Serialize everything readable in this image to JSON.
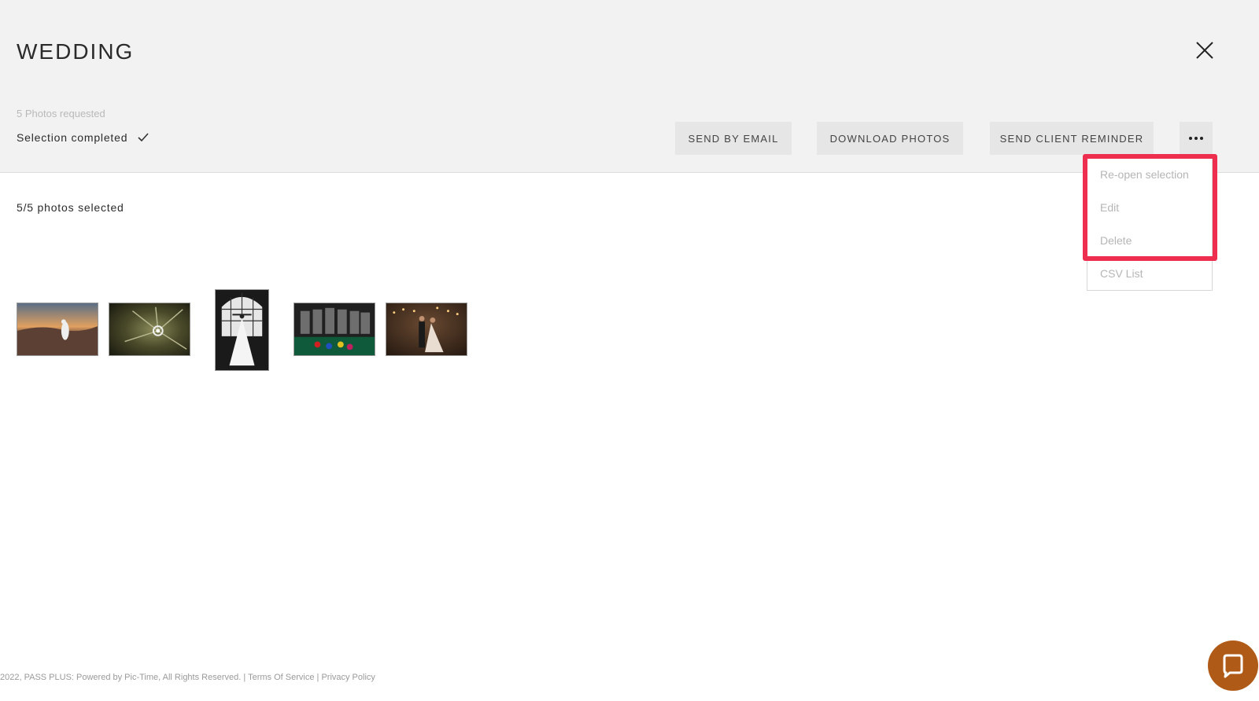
{
  "header": {
    "title": "WEDDING",
    "photos_requested": "5 Photos requested",
    "status_text": "Selection completed"
  },
  "actions": {
    "send_email": "SEND BY EMAIL",
    "download": "DOWNLOAD PHOTOS",
    "reminder": "SEND CLIENT REMINDER"
  },
  "menu": {
    "items": [
      {
        "label": "Re-open selection"
      },
      {
        "label": "Edit"
      },
      {
        "label": "Delete"
      },
      {
        "label": "CSV List"
      }
    ],
    "highlight_color": "#ee2e4e"
  },
  "content": {
    "selected_count": "5/5 photos selected",
    "photos": [
      {
        "icon": "couple-sunset-photo"
      },
      {
        "icon": "ring-flower-photo"
      },
      {
        "icon": "bride-window-photo"
      },
      {
        "icon": "groomsmen-billiards-photo"
      },
      {
        "icon": "couple-night-photo"
      }
    ]
  },
  "footer": {
    "copyright": "2022, PASS PLUS: Powered by Pic-Time, All Rights Reserved.",
    "separator": "|",
    "terms": "Terms Of Service",
    "privacy": "Privacy Policy"
  },
  "colors": {
    "chat_button": "#b05a17",
    "panel_bg": "#f2f2f2"
  }
}
